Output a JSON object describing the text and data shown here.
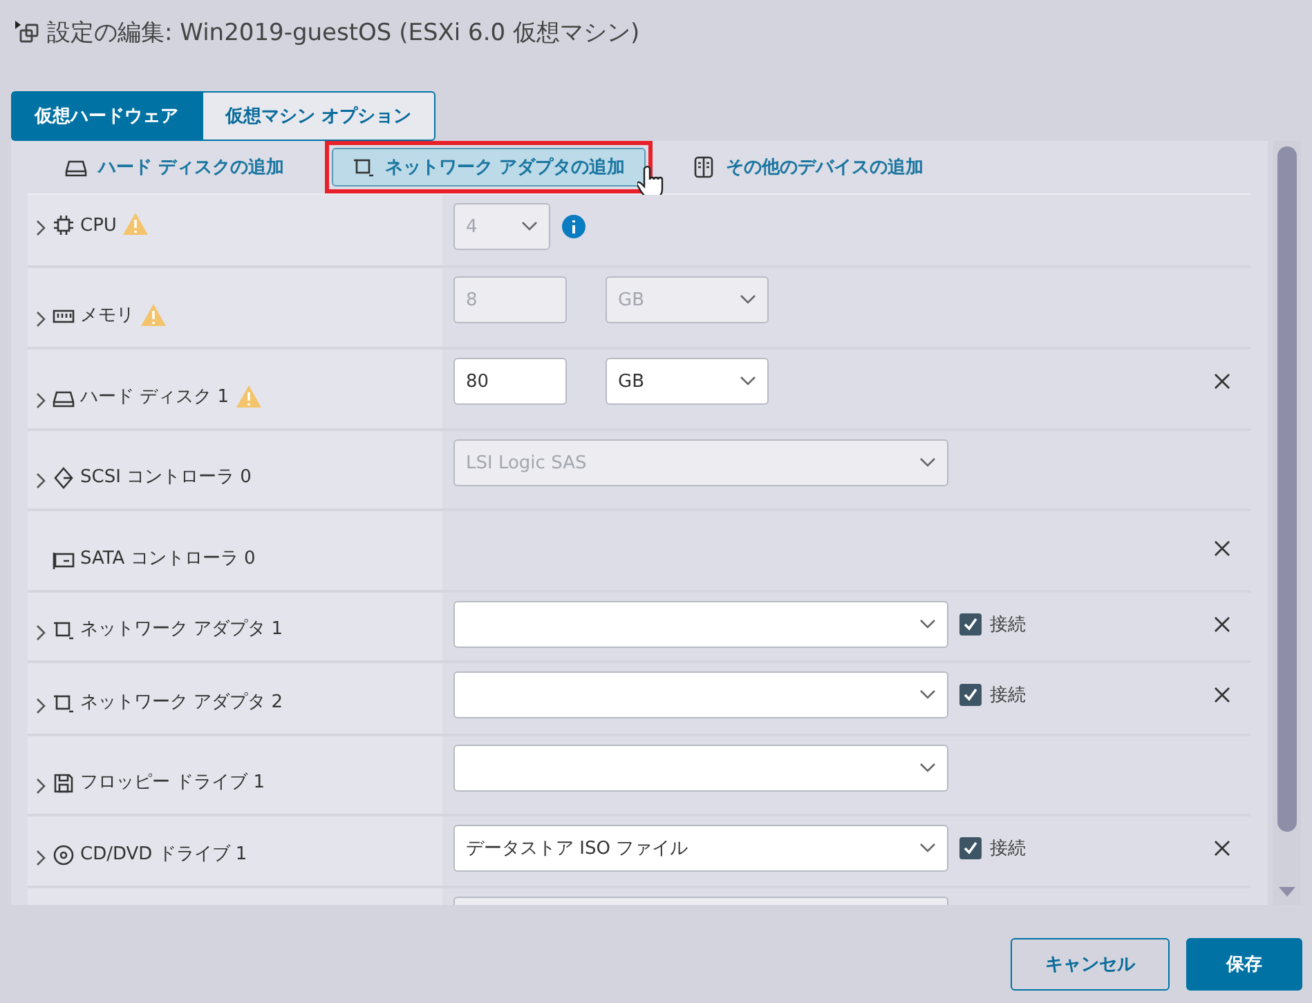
{
  "window": {
    "title": "設定の編集: Win2019-guestOS (ESXi 6.0 仮想マシン)"
  },
  "tabs": [
    {
      "label": "仮想ハードウェア",
      "selected": true
    },
    {
      "label": "仮想マシン オプション",
      "selected": false
    }
  ],
  "toolbar": [
    {
      "kind": "disk",
      "label": "ハード ディスクの追加",
      "highlighted": false
    },
    {
      "kind": "network",
      "label": "ネットワーク アダプタの追加",
      "highlighted": true
    },
    {
      "kind": "device",
      "label": "その他のデバイスの追加",
      "highlighted": false
    }
  ],
  "rows": [
    {
      "kind": "cpu",
      "label": "CPU",
      "expandable": true,
      "warning": true,
      "controls": [
        {
          "kind": "select",
          "value": "4",
          "disabled": true
        }
      ],
      "info": true,
      "removable": false
    },
    {
      "kind": "memory",
      "label": "メモリ",
      "expandable": true,
      "warning": true,
      "controls": [
        {
          "kind": "input",
          "value": "8",
          "disabled": true
        },
        {
          "kind": "select",
          "value": "GB",
          "disabled": true
        }
      ],
      "removable": false
    },
    {
      "kind": "disk",
      "label": "ハード ディスク 1",
      "expandable": true,
      "warning": true,
      "controls": [
        {
          "kind": "input",
          "value": "80",
          "disabled": false
        },
        {
          "kind": "select",
          "value": "GB",
          "disabled": false
        }
      ],
      "removable": true
    },
    {
      "kind": "scsi",
      "label": "SCSI コントローラ 0",
      "expandable": true,
      "warning": false,
      "controls": [
        {
          "kind": "select",
          "value": "LSI Logic SAS",
          "disabled": true
        }
      ],
      "removable": false
    },
    {
      "kind": "sata",
      "label": "SATA コントローラ 0",
      "expandable": false,
      "warning": false,
      "controls": [],
      "removable": true
    },
    {
      "kind": "network",
      "label": "ネットワーク アダプタ 1",
      "expandable": true,
      "warning": false,
      "controls": [
        {
          "kind": "select",
          "disabled": false
        }
      ],
      "connect": {
        "label": "接続",
        "checked": true
      },
      "removable": true
    },
    {
      "kind": "network",
      "label": "ネットワーク アダプタ 2",
      "expandable": true,
      "warning": false,
      "controls": [
        {
          "kind": "select",
          "disabled": false
        }
      ],
      "connect": {
        "label": "接続",
        "checked": true
      },
      "removable": true
    },
    {
      "kind": "floppy",
      "label": "フロッピー ドライブ 1",
      "expandable": true,
      "warning": false,
      "controls": [
        {
          "kind": "select",
          "disabled": false
        }
      ],
      "removable": false
    },
    {
      "kind": "cdrom",
      "label": "CD/DVD ドライブ 1",
      "expandable": true,
      "warning": false,
      "controls": [
        {
          "kind": "select",
          "value": "データストア ISO ファイル",
          "disabled": false
        }
      ],
      "connect": {
        "label": "接続",
        "checked": true
      },
      "removable": true
    }
  ],
  "buttons": [
    {
      "kind": "secondary",
      "label": "キャンセル"
    },
    {
      "kind": "primary",
      "label": "保存"
    }
  ]
}
